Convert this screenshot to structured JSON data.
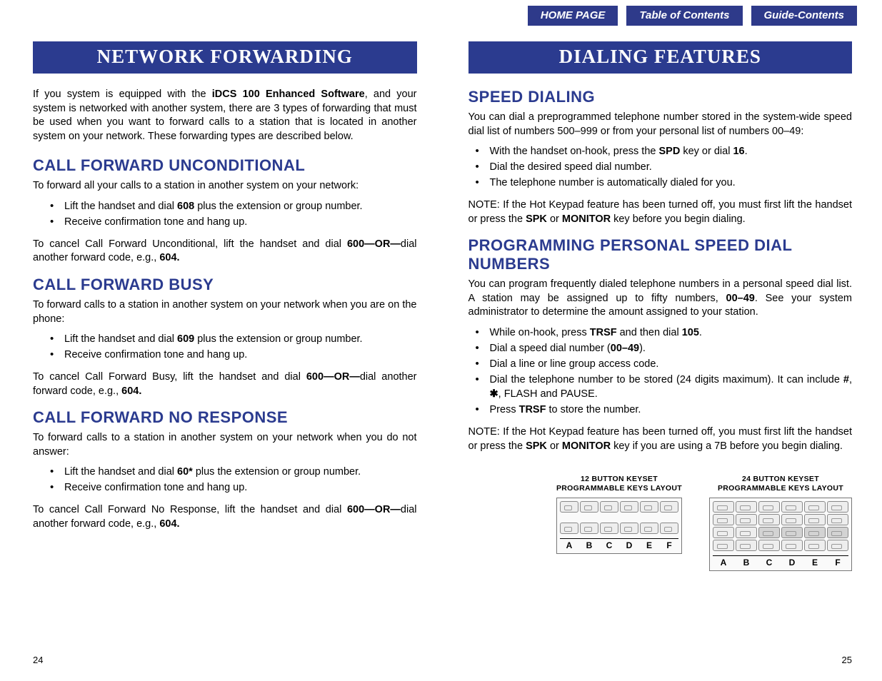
{
  "nav": {
    "home": "HOME PAGE",
    "toc": "Table of Contents",
    "guide": "Guide-Contents"
  },
  "left": {
    "banner": "NETWORK FORWARDING",
    "intro_pre": "If you system is equipped with the ",
    "intro_bold": "iDCS 100 Enhanced Software",
    "intro_post": ", and your system is networked with another system, there are 3 types of forwarding that must be used when you want to forward calls to a station that is located in another system on your network. These forwarding types are described below.",
    "s1_h": "CALL FORWARD UNCONDITIONAL",
    "s1_p": "To forward all your calls to a station in another system on your network:",
    "s1_b1a": "Lift the handset and dial ",
    "s1_b1b": "608",
    "s1_b1c": " plus the extension or group number.",
    "s1_b2": "Receive confirmation tone and hang up.",
    "s1_cancel_a": "To cancel Call Forward Unconditional, lift the handset and dial ",
    "s1_cancel_b": "600",
    "s1_cancel_or": "—OR—",
    "s1_cancel_c": "dial another forward code, e.g., ",
    "s1_cancel_d": "604.",
    "s2_h": "CALL FORWARD BUSY",
    "s2_p": "To forward calls to a station in another system on your network when you are on the phone:",
    "s2_b1a": "Lift the handset and dial ",
    "s2_b1b": "609",
    "s2_b1c": " plus the extension or group number.",
    "s2_b2": "Receive confirmation tone and hang up.",
    "s2_cancel_a": "To cancel Call Forward Busy, lift the handset and dial ",
    "s2_cancel_b": "600",
    "s2_cancel_or": "—OR—",
    "s2_cancel_c": "dial another forward code, e.g., ",
    "s2_cancel_d": "604.",
    "s3_h": "CALL FORWARD NO RESPONSE",
    "s3_p": "To forward calls to a station in another system on your network when you do not answer:",
    "s3_b1a": "Lift the handset and dial ",
    "s3_b1b": "60*",
    "s3_b1c": " plus the extension or group number.",
    "s3_b2": "Receive confirmation tone and hang up.",
    "s3_cancel_a": "To cancel Call Forward No Response, lift the handset and dial ",
    "s3_cancel_b": "600",
    "s3_cancel_or": "—OR—",
    "s3_cancel_c": "dial another forward code, e.g., ",
    "s3_cancel_d": "604.",
    "pagenum": "24"
  },
  "right": {
    "banner": "DIALING FEATURES",
    "s1_h": "SPEED DIALING",
    "s1_p": "You can dial a preprogrammed telephone number stored in the system-wide speed dial list of numbers 500–999 or from your personal list of numbers 00–49:",
    "s1_b1a": "With the handset on-hook, press the ",
    "s1_b1b": "SPD",
    "s1_b1c": " key or dial ",
    "s1_b1d": "16",
    "s1_b1e": ".",
    "s1_b2": "Dial the desired speed dial number.",
    "s1_b3": "The telephone number is automatically dialed for you.",
    "s1_note_a": "NOTE:  If the Hot Keypad feature has been turned off, you must first lift the handset or press the ",
    "s1_note_b": "SPK",
    "s1_note_c": " or ",
    "s1_note_d": "MONITOR",
    "s1_note_e": " key before you begin dialing.",
    "s2_h": "PROGRAMMING PERSONAL SPEED DIAL NUMBERS",
    "s2_p_a": "You can program frequently dialed telephone numbers in a personal speed dial list. A station may be assigned up to fifty numbers, ",
    "s2_p_b": "00–49",
    "s2_p_c": ". See your system administrator to determine the amount assigned to your station.",
    "s2_b1a": "While on-hook, press ",
    "s2_b1b": "TRSF",
    "s2_b1c": " and then dial ",
    "s2_b1d": "105",
    "s2_b1e": ".",
    "s2_b2a": "Dial a speed dial number (",
    "s2_b2b": "00–49",
    "s2_b2c": ").",
    "s2_b3": "Dial a line or line group access code.",
    "s2_b4a": "Dial the telephone number to be stored (24 digits maximum). It can include ",
    "s2_b4b": "#",
    "s2_b4c": ", ",
    "s2_b4d": "✱",
    "s2_b4e": ", FLASH and PAUSE.",
    "s2_b5a": "Press ",
    "s2_b5b": "TRSF",
    "s2_b5c": " to store the number.",
    "s2_note_a": "NOTE:  If the Hot Keypad feature has been turned off, you must first lift the handset or press the ",
    "s2_note_b": "SPK",
    "s2_note_c": " or ",
    "s2_note_d": "MONITOR",
    "s2_note_e": " key if you are using a 7B before you begin dialing.",
    "kp12_t1": "12 BUTTON KEYSET",
    "kp12_t2": "PROGRAMMABLE KEYS LAYOUT",
    "kp24_t1": "24 BUTTON KEYSET",
    "kp24_t2": "PROGRAMMABLE KEYS LAYOUT",
    "lblA": "A",
    "lblB": "B",
    "lblC": "C",
    "lblD": "D",
    "lblE": "E",
    "lblF": "F",
    "pagenum": "25"
  }
}
